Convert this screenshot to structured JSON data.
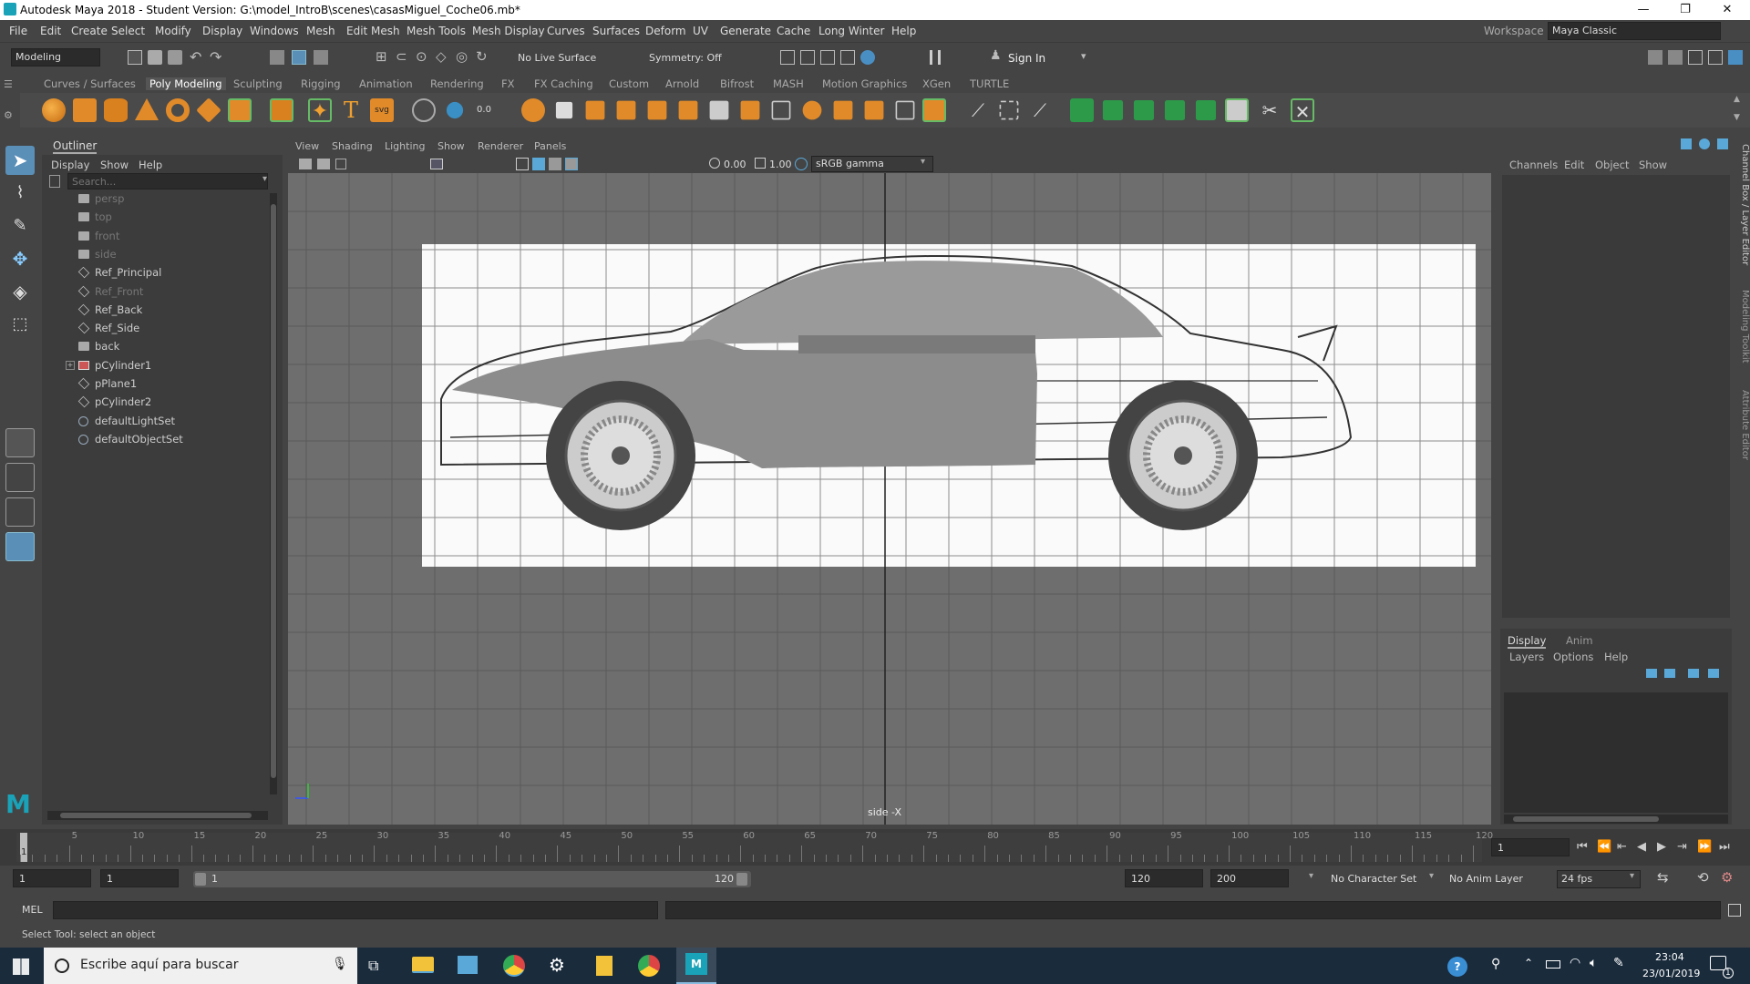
{
  "window": {
    "title": "Autodesk Maya 2018 - Student Version: G:\\model_IntroB\\scenes\\casasMiguel_Coche06.mb*",
    "minimize": "—",
    "maximize": "❐",
    "close": "✕"
  },
  "menubar": {
    "items": [
      "File",
      "Edit",
      "Create",
      "Select",
      "Modify",
      "Display",
      "Windows",
      "Mesh",
      "Edit Mesh",
      "Mesh Tools",
      "Mesh Display",
      "Curves",
      "Surfaces",
      "Deform",
      "UV",
      "Generate",
      "Cache",
      "Long Winter",
      "Help"
    ],
    "workspace_label": "Workspace :",
    "workspace_value": "Maya Classic"
  },
  "statusline": {
    "mode": "Modeling",
    "live_surface": "No Live Surface",
    "symmetry": "Symmetry: Off",
    "sign_in": "Sign In"
  },
  "shelf": {
    "tabs": [
      "Curves / Surfaces",
      "Poly Modeling",
      "Sculpting",
      "Rigging",
      "Animation",
      "Rendering",
      "FX",
      "FX Caching",
      "Custom",
      "Arnold",
      "Bifrost",
      "MASH",
      "Motion Graphics",
      "XGen",
      "TURTLE"
    ],
    "active_tab": "Poly Modeling"
  },
  "outliner": {
    "title": "Outliner",
    "menu": [
      "Display",
      "Show",
      "Help"
    ],
    "search_placeholder": "Search...",
    "items": [
      {
        "label": "persp",
        "dim": true,
        "icon": "camera-icon"
      },
      {
        "label": "top",
        "dim": true,
        "icon": "camera-icon"
      },
      {
        "label": "front",
        "dim": true,
        "icon": "camera-icon"
      },
      {
        "label": "side",
        "dim": true,
        "icon": "camera-icon"
      },
      {
        "label": "Ref_Principal",
        "dim": false,
        "icon": "mesh-icon"
      },
      {
        "label": "Ref_Front",
        "dim": true,
        "icon": "mesh-icon"
      },
      {
        "label": "Ref_Back",
        "dim": false,
        "icon": "mesh-icon"
      },
      {
        "label": "Ref_Side",
        "dim": false,
        "icon": "mesh-icon"
      },
      {
        "label": "back",
        "dim": false,
        "icon": "camera-icon"
      },
      {
        "label": "pCylinder1",
        "dim": false,
        "icon": "cylinder-icon"
      },
      {
        "label": "pPlane1",
        "dim": false,
        "icon": "mesh-icon"
      },
      {
        "label": "pCylinder2",
        "dim": false,
        "icon": "mesh-icon"
      },
      {
        "label": "defaultLightSet",
        "dim": false,
        "icon": "set-icon"
      },
      {
        "label": "defaultObjectSet",
        "dim": false,
        "icon": "set-icon"
      }
    ]
  },
  "viewport": {
    "menu": [
      "View",
      "Shading",
      "Lighting",
      "Show",
      "Renderer",
      "Panels"
    ],
    "exposure": "0.00",
    "gamma": "1.00",
    "color_space": "sRGB gamma",
    "camera_label": "side -X"
  },
  "channelbox": {
    "menu": [
      "Channels",
      "Edit",
      "Object",
      "Show"
    ],
    "side_tabs": [
      "Channel Box / Layer Editor",
      "Modeling Toolkit",
      "Attribute Editor"
    ]
  },
  "layereditor": {
    "tabs": [
      "Display",
      "Anim"
    ],
    "menu": [
      "Layers",
      "Options",
      "Help"
    ]
  },
  "timeline": {
    "ticks": [
      "5",
      "10",
      "15",
      "20",
      "25",
      "30",
      "35",
      "40",
      "45",
      "50",
      "55",
      "60",
      "65",
      "70",
      "75",
      "80",
      "85",
      "90",
      "95",
      "100",
      "105",
      "110",
      "115",
      "120"
    ],
    "current_frame": "1",
    "current_frame_field": "1"
  },
  "rangebar": {
    "start": "1",
    "playback_start": "1",
    "slider_start": "1",
    "slider_end": "120",
    "playback_end": "120",
    "end": "200",
    "character_set": "No Character Set",
    "anim_layer": "No Anim Layer",
    "fps": "24 fps"
  },
  "cmdline": {
    "label": "MEL"
  },
  "helpline": {
    "text": "Select Tool: select an object"
  },
  "taskbar": {
    "search_placeholder": "Escribe aquí para buscar",
    "time": "23:04",
    "date": "23/01/2019",
    "notifications": "1"
  }
}
